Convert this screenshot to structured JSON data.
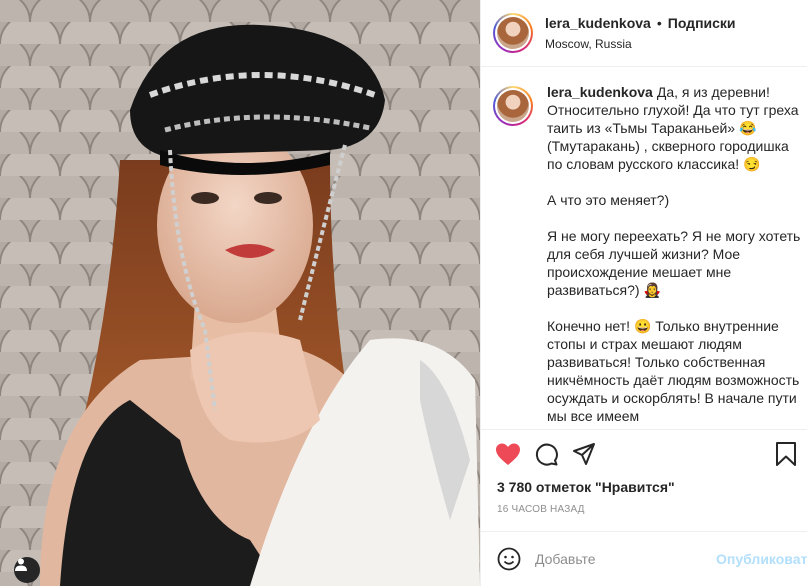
{
  "post": {
    "username": "lera_kudenkova",
    "follow_label": "Подписки",
    "location": "Moscow, Russia",
    "caption_paragraphs": [
      "Да, я из деревни! Относительно глухой! Да что тут греха таить из «Тьмы Тараканьей» 😂 (Тмутаракань) , скверного городишка по словам русского классика! 😏",
      "А что это меняет?)",
      "Я не могу переехать? Я не могу хотеть для себя лучшей жизни? Мое происхождение мешает мне развиваться?) 🧛‍♀️",
      "Конечно нет! 😀 Только внутренние стопы и страх мешают людям развиваться! Только собственная никчёмность даёт людям возможность осуждать и оскорблять! В начале пути мы все имеем"
    ],
    "likes": "3 780 отметок \"Нравится\"",
    "timestamp": "16 ЧАСОВ НАЗАД"
  },
  "comment": {
    "placeholder": "Добавьте",
    "publish_label": "Опубликовать"
  },
  "colors": {
    "like_red": "#ed4956",
    "publish_disabled": "#b2dffc",
    "muted": "#8e8e8e"
  },
  "icons": {
    "like": "heart-filled-icon",
    "comment": "comment-bubble-icon",
    "share": "paper-plane-icon",
    "save": "bookmark-icon",
    "emoji": "smiley-icon",
    "tag": "user-tag-icon"
  }
}
